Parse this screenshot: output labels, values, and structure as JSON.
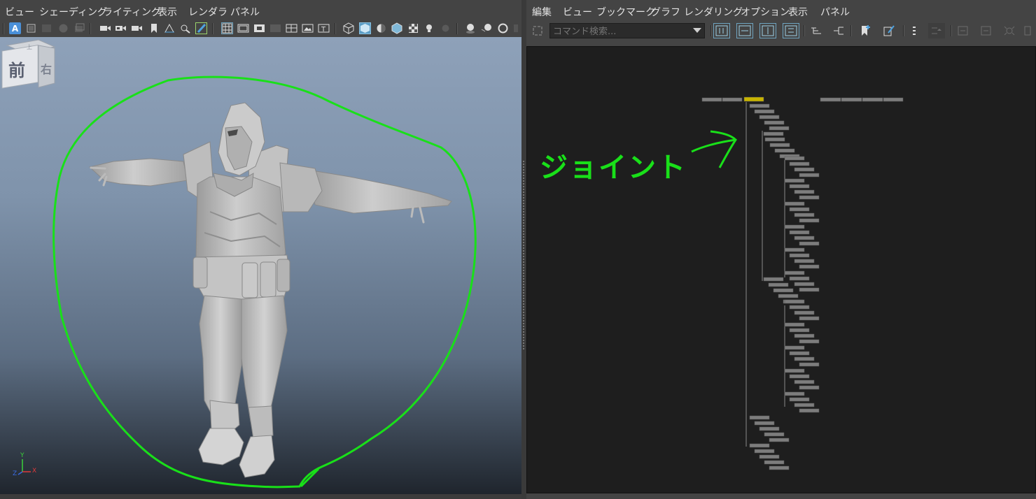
{
  "left_panel": {
    "menu": [
      "ビュー",
      "シェーディング",
      "ライティング",
      "表示",
      "レンダラ",
      "パネル"
    ],
    "toolbar_icons": [
      "camera-select-icon",
      "image-plane-icon",
      "grid-toggle-icon",
      "film-gate-icon",
      "resolution-gate-icon",
      "camera-icon",
      "camera-attributes-icon",
      "camera-bookmark-icon",
      "bookmark-icon",
      "bounding-box-icon",
      "isolate-icon",
      "brush-icon",
      "grid-icon",
      "safe-frame-icon",
      "gate-mask-icon",
      "field-chart-icon",
      "resolution-icon",
      "image-icon",
      "text-icon",
      "wireframe-icon",
      "smooth-shade-icon",
      "default-material-icon",
      "shaded-wireframe-icon",
      "textured-icon",
      "lights-icon",
      "shadows-icon",
      "screen-space-ao-icon",
      "motion-blur-icon",
      "anti-alias-icon"
    ],
    "viewcube": {
      "front_label": "前",
      "right_label": "右",
      "top_label": "上"
    },
    "axis": {
      "y": "Y",
      "x": "X",
      "z": "Z"
    }
  },
  "right_panel": {
    "menu": [
      "編集",
      "ビュー",
      "ブックマーク",
      "グラフ",
      "レンダリング",
      "オプション",
      "表示",
      "パネル"
    ],
    "search": {
      "placeholder": "コマンド検索..."
    },
    "annotation": "ジョイント",
    "colors": {
      "annotation": "#19e019",
      "selected_node": "#c8b400",
      "node": "#7d7d7d",
      "background": "#1e1e1e"
    }
  }
}
